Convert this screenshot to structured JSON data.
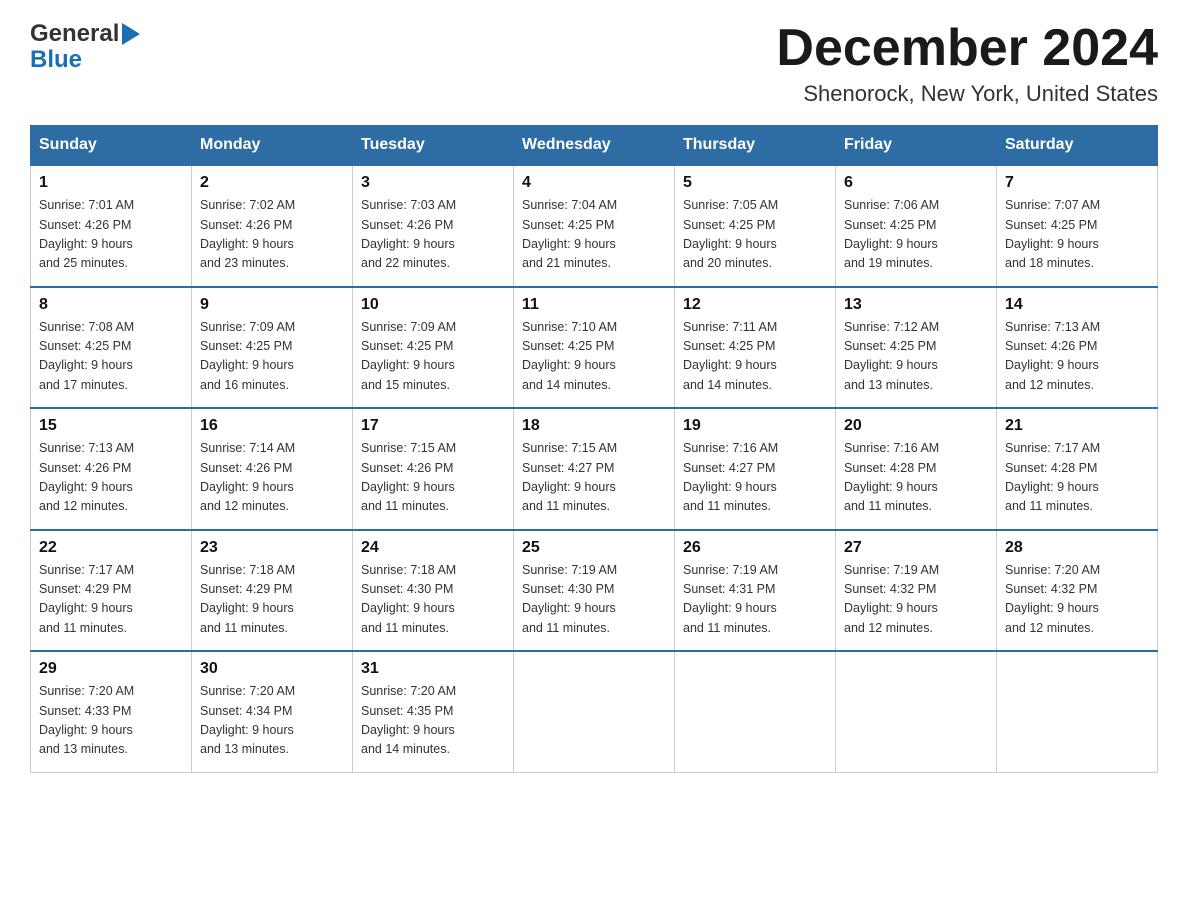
{
  "header": {
    "logo_line1": "General",
    "logo_line2": "Blue",
    "month_title": "December 2024",
    "location": "Shenorock, New York, United States"
  },
  "weekdays": [
    "Sunday",
    "Monday",
    "Tuesday",
    "Wednesday",
    "Thursday",
    "Friday",
    "Saturday"
  ],
  "weeks": [
    [
      {
        "day": "1",
        "sunrise": "7:01 AM",
        "sunset": "4:26 PM",
        "daylight": "9 hours and 25 minutes."
      },
      {
        "day": "2",
        "sunrise": "7:02 AM",
        "sunset": "4:26 PM",
        "daylight": "9 hours and 23 minutes."
      },
      {
        "day": "3",
        "sunrise": "7:03 AM",
        "sunset": "4:26 PM",
        "daylight": "9 hours and 22 minutes."
      },
      {
        "day": "4",
        "sunrise": "7:04 AM",
        "sunset": "4:25 PM",
        "daylight": "9 hours and 21 minutes."
      },
      {
        "day": "5",
        "sunrise": "7:05 AM",
        "sunset": "4:25 PM",
        "daylight": "9 hours and 20 minutes."
      },
      {
        "day": "6",
        "sunrise": "7:06 AM",
        "sunset": "4:25 PM",
        "daylight": "9 hours and 19 minutes."
      },
      {
        "day": "7",
        "sunrise": "7:07 AM",
        "sunset": "4:25 PM",
        "daylight": "9 hours and 18 minutes."
      }
    ],
    [
      {
        "day": "8",
        "sunrise": "7:08 AM",
        "sunset": "4:25 PM",
        "daylight": "9 hours and 17 minutes."
      },
      {
        "day": "9",
        "sunrise": "7:09 AM",
        "sunset": "4:25 PM",
        "daylight": "9 hours and 16 minutes."
      },
      {
        "day": "10",
        "sunrise": "7:09 AM",
        "sunset": "4:25 PM",
        "daylight": "9 hours and 15 minutes."
      },
      {
        "day": "11",
        "sunrise": "7:10 AM",
        "sunset": "4:25 PM",
        "daylight": "9 hours and 14 minutes."
      },
      {
        "day": "12",
        "sunrise": "7:11 AM",
        "sunset": "4:25 PM",
        "daylight": "9 hours and 14 minutes."
      },
      {
        "day": "13",
        "sunrise": "7:12 AM",
        "sunset": "4:25 PM",
        "daylight": "9 hours and 13 minutes."
      },
      {
        "day": "14",
        "sunrise": "7:13 AM",
        "sunset": "4:26 PM",
        "daylight": "9 hours and 12 minutes."
      }
    ],
    [
      {
        "day": "15",
        "sunrise": "7:13 AM",
        "sunset": "4:26 PM",
        "daylight": "9 hours and 12 minutes."
      },
      {
        "day": "16",
        "sunrise": "7:14 AM",
        "sunset": "4:26 PM",
        "daylight": "9 hours and 12 minutes."
      },
      {
        "day": "17",
        "sunrise": "7:15 AM",
        "sunset": "4:26 PM",
        "daylight": "9 hours and 11 minutes."
      },
      {
        "day": "18",
        "sunrise": "7:15 AM",
        "sunset": "4:27 PM",
        "daylight": "9 hours and 11 minutes."
      },
      {
        "day": "19",
        "sunrise": "7:16 AM",
        "sunset": "4:27 PM",
        "daylight": "9 hours and 11 minutes."
      },
      {
        "day": "20",
        "sunrise": "7:16 AM",
        "sunset": "4:28 PM",
        "daylight": "9 hours and 11 minutes."
      },
      {
        "day": "21",
        "sunrise": "7:17 AM",
        "sunset": "4:28 PM",
        "daylight": "9 hours and 11 minutes."
      }
    ],
    [
      {
        "day": "22",
        "sunrise": "7:17 AM",
        "sunset": "4:29 PM",
        "daylight": "9 hours and 11 minutes."
      },
      {
        "day": "23",
        "sunrise": "7:18 AM",
        "sunset": "4:29 PM",
        "daylight": "9 hours and 11 minutes."
      },
      {
        "day": "24",
        "sunrise": "7:18 AM",
        "sunset": "4:30 PM",
        "daylight": "9 hours and 11 minutes."
      },
      {
        "day": "25",
        "sunrise": "7:19 AM",
        "sunset": "4:30 PM",
        "daylight": "9 hours and 11 minutes."
      },
      {
        "day": "26",
        "sunrise": "7:19 AM",
        "sunset": "4:31 PM",
        "daylight": "9 hours and 11 minutes."
      },
      {
        "day": "27",
        "sunrise": "7:19 AM",
        "sunset": "4:32 PM",
        "daylight": "9 hours and 12 minutes."
      },
      {
        "day": "28",
        "sunrise": "7:20 AM",
        "sunset": "4:32 PM",
        "daylight": "9 hours and 12 minutes."
      }
    ],
    [
      {
        "day": "29",
        "sunrise": "7:20 AM",
        "sunset": "4:33 PM",
        "daylight": "9 hours and 13 minutes."
      },
      {
        "day": "30",
        "sunrise": "7:20 AM",
        "sunset": "4:34 PM",
        "daylight": "9 hours and 13 minutes."
      },
      {
        "day": "31",
        "sunrise": "7:20 AM",
        "sunset": "4:35 PM",
        "daylight": "9 hours and 14 minutes."
      },
      null,
      null,
      null,
      null
    ]
  ],
  "labels": {
    "sunrise": "Sunrise: ",
    "sunset": "Sunset: ",
    "daylight": "Daylight: "
  }
}
